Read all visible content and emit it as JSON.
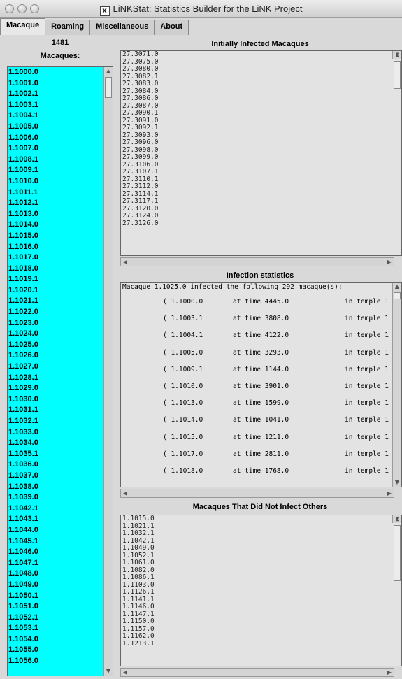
{
  "window": {
    "title": "LiNKStat: Statistics Builder for the LiNK Project"
  },
  "tabs": [
    "Macaque",
    "Roaming",
    "Miscellaneous",
    "About"
  ],
  "left": {
    "count": "1481",
    "label": "Macaques:",
    "items": [
      "1.1000.0",
      "1.1001.0",
      "1.1002.1",
      "1.1003.1",
      "1.1004.1",
      "1.1005.0",
      "1.1006.0",
      "1.1007.0",
      "1.1008.1",
      "1.1009.1",
      "1.1010.0",
      "1.1011.1",
      "1.1012.1",
      "1.1013.0",
      "1.1014.0",
      "1.1015.0",
      "1.1016.0",
      "1.1017.0",
      "1.1018.0",
      "1.1019.1",
      "1.1020.1",
      "1.1021.1",
      "1.1022.0",
      "1.1023.0",
      "1.1024.0",
      "1.1025.0",
      "1.1026.0",
      "1.1027.0",
      "1.1028.1",
      "1.1029.0",
      "1.1030.0",
      "1.1031.1",
      "1.1032.1",
      "1.1033.0",
      "1.1034.0",
      "1.1035.1",
      "1.1036.0",
      "1.1037.0",
      "1.1038.0",
      "1.1039.0",
      "1.1042.1",
      "1.1043.1",
      "1.1044.0",
      "1.1045.1",
      "1.1046.0",
      "1.1047.1",
      "1.1048.0",
      "1.1049.0",
      "1.1050.1",
      "1.1051.0",
      "1.1052.1",
      "1.1053.1",
      "1.1054.0",
      "1.1055.0",
      "1.1056.0"
    ]
  },
  "initially_infected": {
    "title": "Initially Infected Macaques",
    "lines": [
      "27.3071.0",
      "27.3075.0",
      "27.3080.0",
      "27.3082.1",
      "27.3083.0",
      "27.3084.0",
      "27.3086.0",
      "27.3087.0",
      "27.3090.1",
      "27.3091.0",
      "27.3092.1",
      "27.3093.0",
      "27.3096.0",
      "27.3098.0",
      "27.3099.0",
      "27.3106.0",
      "27.3107.1",
      "27.3110.1",
      "27.3112.0",
      "27.3114.1",
      "27.3117.1",
      "27.3120.0",
      "27.3124.0",
      "27.3126.0"
    ]
  },
  "infection_stats": {
    "title": "Infection statistics",
    "header": "Macaque 1.1025.0 infected the following 292 macaque(s):",
    "rows": [
      {
        "id": "( 1.1000.0",
        "time": "at time 4445.0",
        "temple": "in temple 1 )"
      },
      {
        "id": "( 1.1003.1",
        "time": "at time 3808.0",
        "temple": "in temple 1 )"
      },
      {
        "id": "( 1.1004.1",
        "time": "at time 4122.0",
        "temple": "in temple 1 )"
      },
      {
        "id": "( 1.1005.0",
        "time": "at time 3293.0",
        "temple": "in temple 1 )"
      },
      {
        "id": "( 1.1009.1",
        "time": "at time 1144.0",
        "temple": "in temple 1 )"
      },
      {
        "id": "( 1.1010.0",
        "time": "at time 3901.0",
        "temple": "in temple 1 )"
      },
      {
        "id": "( 1.1013.0",
        "time": "at time 1599.0",
        "temple": "in temple 1 )"
      },
      {
        "id": "( 1.1014.0",
        "time": "at time 1041.0",
        "temple": "in temple 1 )"
      },
      {
        "id": "( 1.1015.0",
        "time": "at time 1211.0",
        "temple": "in temple 1 )"
      },
      {
        "id": "( 1.1017.0",
        "time": "at time 2811.0",
        "temple": "in temple 1 )"
      },
      {
        "id": "( 1.1018.0",
        "time": "at time 1768.0",
        "temple": "in temple 1 )"
      }
    ]
  },
  "non_infectors": {
    "title": "Macaques That Did Not Infect Others",
    "lines": [
      "1.1015.0",
      "1.1021.1",
      "1.1032.1",
      "1.1042.1",
      "1.1049.0",
      "1.1052.1",
      "1.1061.0",
      "1.1082.0",
      "1.1086.1",
      "1.1103.0",
      "1.1126.1",
      "1.1141.1",
      "1.1146.0",
      "1.1147.1",
      "1.1150.0",
      "1.1157.0",
      "1.1162.0",
      "1.1213.1"
    ]
  },
  "colors": {
    "list_bg": "#00ffff",
    "window_bg": "#d9d9d9",
    "text_bg": "#e3e3e3"
  }
}
